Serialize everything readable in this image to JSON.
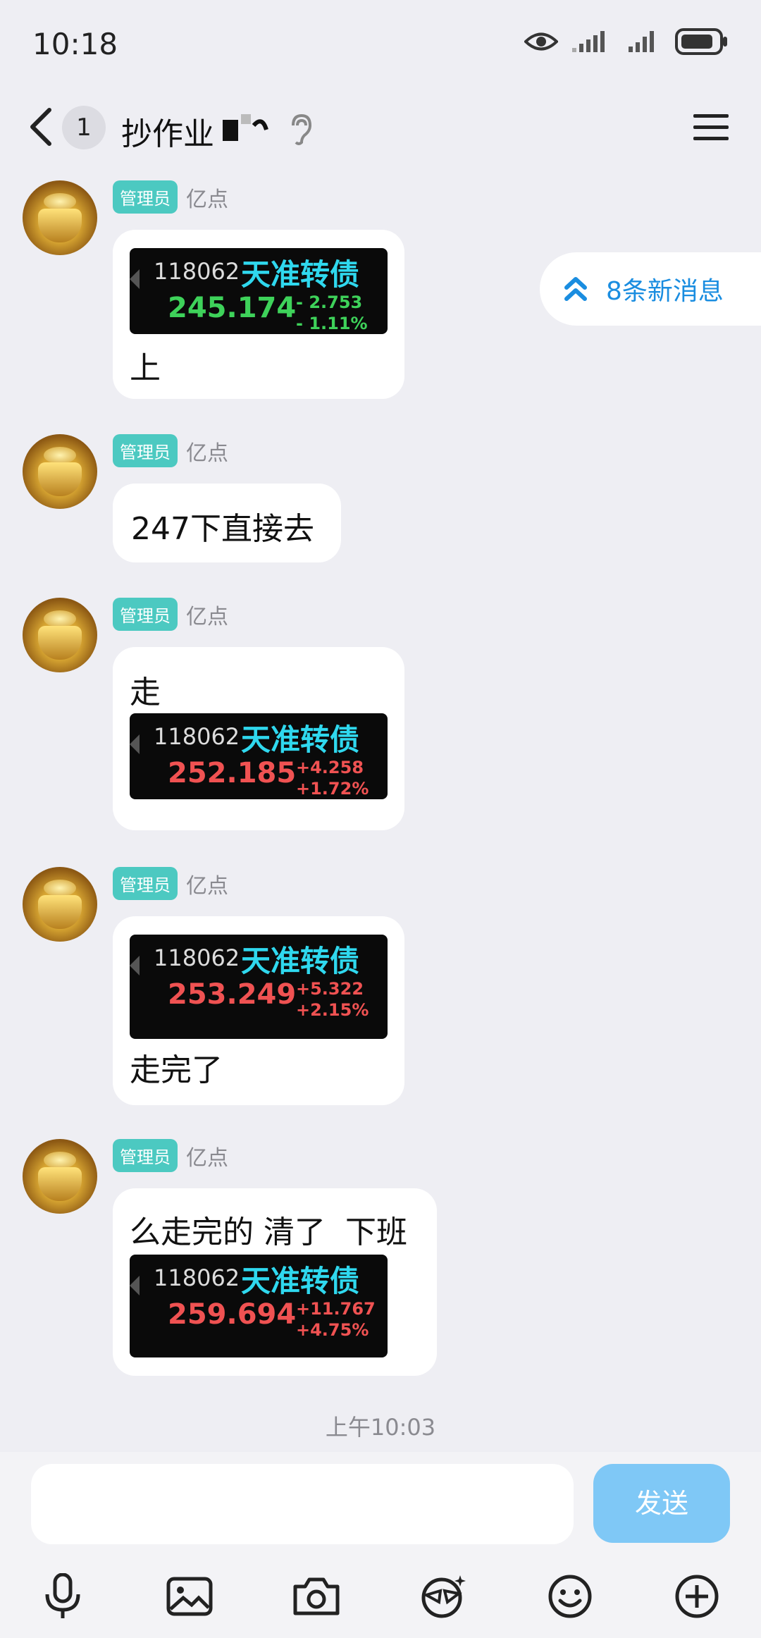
{
  "status": {
    "time": "10:18"
  },
  "header": {
    "unread_count": "1",
    "title": "抄作业"
  },
  "floating": {
    "new_messages": "8条新消息"
  },
  "messages": [
    {
      "role": "管理员",
      "name": "亿点",
      "text_after": "上",
      "stock": {
        "code": "118062",
        "name": "天准转债",
        "price": "245.174",
        "change": "- 2.753",
        "pct": "- 1.11%",
        "direction": "down"
      }
    },
    {
      "role": "管理员",
      "name": "亿点",
      "text": "247下直接去"
    },
    {
      "role": "管理员",
      "name": "亿点",
      "text_before": "走",
      "stock": {
        "code": "118062",
        "name": "天准转债",
        "price": "252.185",
        "change": "+4.258",
        "pct": "+1.72%",
        "direction": "up"
      }
    },
    {
      "role": "管理员",
      "name": "亿点",
      "text_after": "走完了",
      "stock": {
        "code": "118062",
        "name": "天准转债",
        "price": "253.249",
        "change": "+5.322",
        "pct": "+2.15%",
        "direction": "up"
      }
    },
    {
      "role": "管理员",
      "name": "亿点",
      "text_before": "么走完的 清了  下班",
      "stock": {
        "code": "118062",
        "name": "天准转债",
        "price": "259.694",
        "change": "+11.767",
        "pct": "+4.75%",
        "direction": "up"
      }
    }
  ],
  "timestamp": "上午10:03",
  "input": {
    "send_label": "发送",
    "placeholder": ""
  },
  "toolbar": {
    "icons": [
      "microphone-icon",
      "image-icon",
      "camera-icon",
      "sticker-icon",
      "emoji-icon",
      "plus-icon"
    ]
  },
  "colors": {
    "accent": "#1a8de0",
    "role_tag": "#4cc9c1",
    "send_button": "#7fc8f6",
    "price_up": "#f05252",
    "price_down": "#3ed25a"
  }
}
